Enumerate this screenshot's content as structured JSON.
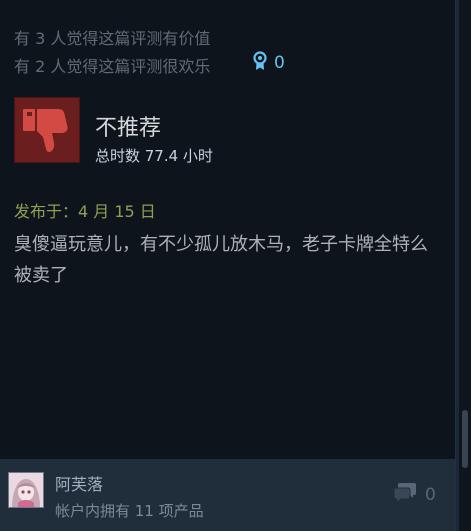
{
  "review": {
    "helpful_text": "有 3 人觉得这篇评测有价值",
    "funny_text": "有 2 人觉得这篇评测很欢乐",
    "award_count": "0",
    "verdict": "不推荐",
    "hours": "总时数 77.4 小时",
    "posted": "发布于：4 月 15 日",
    "content": "臭傻逼玩意儿，有不少孤儿放木马，老子卡牌全特么被卖了"
  },
  "author": {
    "name": "阿芙落",
    "products": "帐户内拥有 11 项产品"
  },
  "comments": {
    "count": "0"
  },
  "colors": {
    "background": "#0e141b",
    "thumb_down_bg": "#6a1e1e",
    "thumb_down_icon": "#d24a43",
    "posted_green": "#8ea052",
    "award_blue": "#66c0f4",
    "footer_bg": "#202d3b"
  },
  "icons": {
    "thumb": "thumbs-down-icon",
    "award": "award-ribbon-icon",
    "comment": "comment-bubbles-icon"
  }
}
